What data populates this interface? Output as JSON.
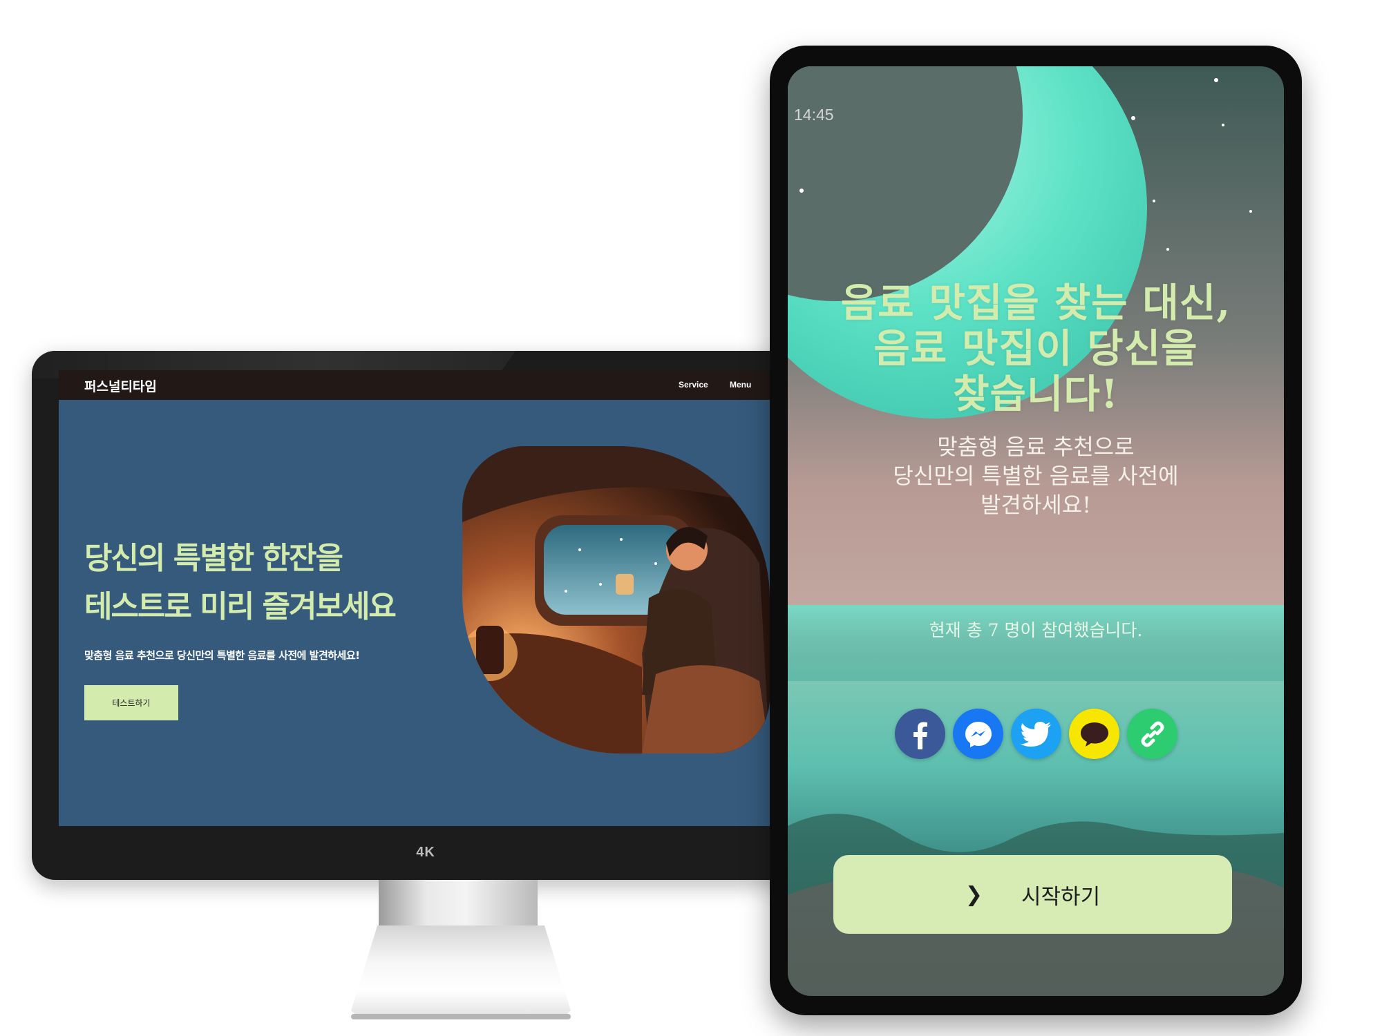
{
  "desktop": {
    "brand": "퍼스널티타임",
    "nav": {
      "service": "Service",
      "menu": "Menu"
    },
    "hero": {
      "title_line1": "당신의 특별한 한잔을",
      "title_line2": "테스트로 미리 즐겨보세요",
      "subtitle": "맞춤형 음료 추천으로 당신만의 특별한 음료를 사전에 발견하세요!",
      "cta": "테스트하기"
    },
    "monitor_label": "4K"
  },
  "mobile": {
    "clock": "14:45",
    "headline": [
      "음료 맛집을 찾는 대신,",
      "음료 맛집이 당신을",
      "찾습니다!"
    ],
    "subtitle": [
      "맞춤형 음료 추천으로",
      "당신만의 특별한 음료를 사전에",
      "발견하세요!"
    ],
    "participants": "현재 총 7 명이 참여했습니다.",
    "share_icons": [
      "facebook-icon",
      "messenger-icon",
      "twitter-icon",
      "kakaotalk-icon",
      "link-icon"
    ],
    "start_button": "시작하기"
  },
  "colors": {
    "accent": "#d3ebac",
    "site_bg": "#355a7c",
    "nav_bg": "#221916"
  }
}
